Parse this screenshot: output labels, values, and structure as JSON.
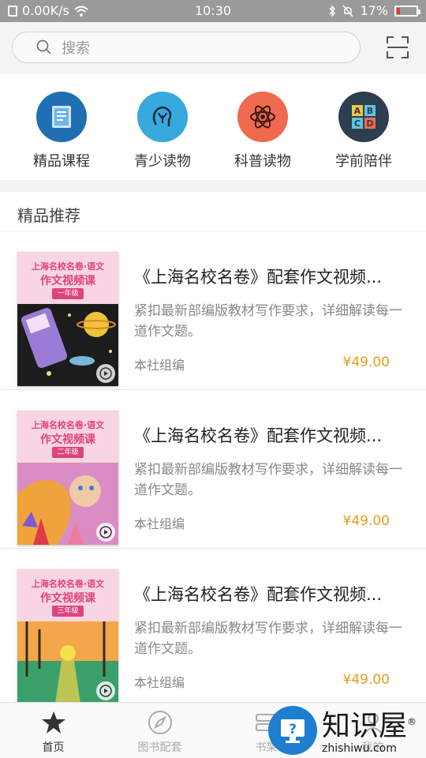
{
  "status_bar": {
    "speed": "0.00K/s",
    "time": "10:30",
    "battery": "17%",
    "battery_level": 0.17
  },
  "search": {
    "placeholder": "搜索",
    "scan_icon": "scan-icon"
  },
  "categories": [
    {
      "label": "精品课程",
      "icon": "book-icon",
      "color": "#1f6fb2"
    },
    {
      "label": "青少读物",
      "icon": "brain-icon",
      "color": "#37a9dc"
    },
    {
      "label": "科普读物",
      "icon": "atom-icon",
      "color": "#f06a4f"
    },
    {
      "label": "学前陪伴",
      "icon": "abc-blocks-icon",
      "color": "#2c3e50"
    }
  ],
  "section": {
    "title": "精品推荐"
  },
  "products": [
    {
      "cover_series": "上海名校名卷·语文",
      "cover_title": "作文视频课",
      "cover_grade": "一年级",
      "title": "《上海名校名卷》配套作文视频...",
      "description": "紧扣最新部编版教材写作要求，详细解读每一道作文题。",
      "publisher": "本社组编",
      "price": "¥49.00"
    },
    {
      "cover_series": "上海名校名卷·语文",
      "cover_title": "作文视频课",
      "cover_grade": "二年级",
      "title": "《上海名校名卷》配套作文视频...",
      "description": "紧扣最新部编版教材写作要求，详细解读每一道作文题。",
      "publisher": "本社组编",
      "price": "¥49.00"
    },
    {
      "cover_series": "上海名校名卷·语文",
      "cover_title": "作文视频课",
      "cover_grade": "三年级",
      "title": "《上海名校名卷》配套作文视频...",
      "description": "紧扣最新部编版教材写作要求，详细解读每一道作文题。",
      "publisher": "本社组编",
      "price": "¥49.00"
    }
  ],
  "tabbar": [
    {
      "label": "首页",
      "icon": "star-icon",
      "active": true
    },
    {
      "label": "图书配套",
      "icon": "compass-icon",
      "active": false
    },
    {
      "label": "书架",
      "icon": "bookshelf-icon",
      "active": false
    },
    {
      "label": "我的",
      "icon": "user-icon",
      "active": false
    }
  ],
  "watermark": {
    "cn": "知识屋",
    "en": "zhishiwu.com",
    "mark": "®"
  }
}
